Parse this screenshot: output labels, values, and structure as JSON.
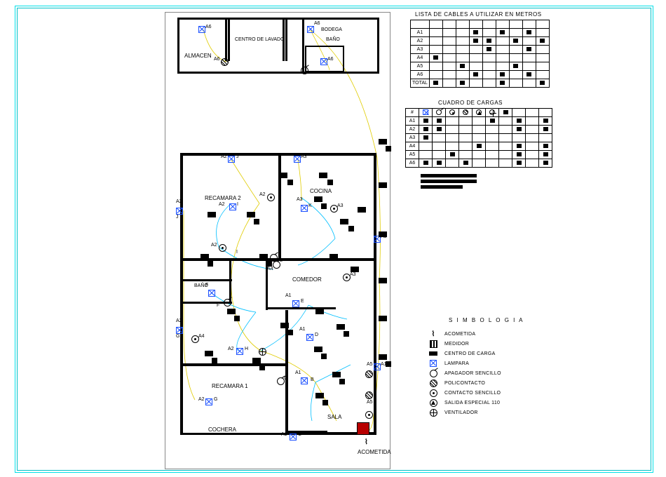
{
  "rooms": {
    "almacen": "ALMACEN",
    "centro_lavado": "CENTRO DE LAVADO",
    "bodega": "BODEGA",
    "bano_top": "BAÑO",
    "recamara2": "RECAMARA 2",
    "cocina": "COCINA",
    "bano": "BAÑO",
    "comedor": "COMEDOR",
    "recamara1": "RECAMARA 1",
    "sala": "SALA",
    "cochera": "COCHERA"
  },
  "acometida_label": "ACOMETIDA",
  "table_cables": {
    "title": "LISTA DE CABLES A UTILIZAR EN METROS",
    "rows": [
      "A1",
      "A2",
      "A3",
      "A4",
      "A5",
      "A6",
      "TOTAL"
    ]
  },
  "table_cargas": {
    "title": "CUADRO DE CARGAS",
    "header": "#",
    "rows": [
      "A1",
      "A2",
      "A3",
      "A4",
      "A5",
      "A6"
    ]
  },
  "simbologia": {
    "title": "S I M B O L O G I A",
    "items": [
      {
        "key": "acometida",
        "text": "ACOMETIDA"
      },
      {
        "key": "medidor",
        "text": "MEDIDOR"
      },
      {
        "key": "centro_carga",
        "text": "CENTRO DE CARGA"
      },
      {
        "key": "lampara",
        "text": "LAMPARA"
      },
      {
        "key": "apagador",
        "text": "APAGADOR SENCILLO"
      },
      {
        "key": "policontacto",
        "text": "POLICONTACTO"
      },
      {
        "key": "contacto",
        "text": "CONTACTO SENCILLO"
      },
      {
        "key": "salida110",
        "text": "SALIDA ESPECIAL 110"
      },
      {
        "key": "ventilador",
        "text": "VENTILADOR"
      }
    ]
  },
  "circuit_tags": {
    "a1": "A1",
    "a2": "A2",
    "a3": "A3",
    "a4": "A4",
    "a5": "A5",
    "a6": "A6",
    "b": "B",
    "c": "C",
    "d": "D",
    "e": "E",
    "f": "F",
    "g": "G",
    "h": "H",
    "i": "I",
    "j": "J",
    "k": "K",
    "l": "L"
  }
}
